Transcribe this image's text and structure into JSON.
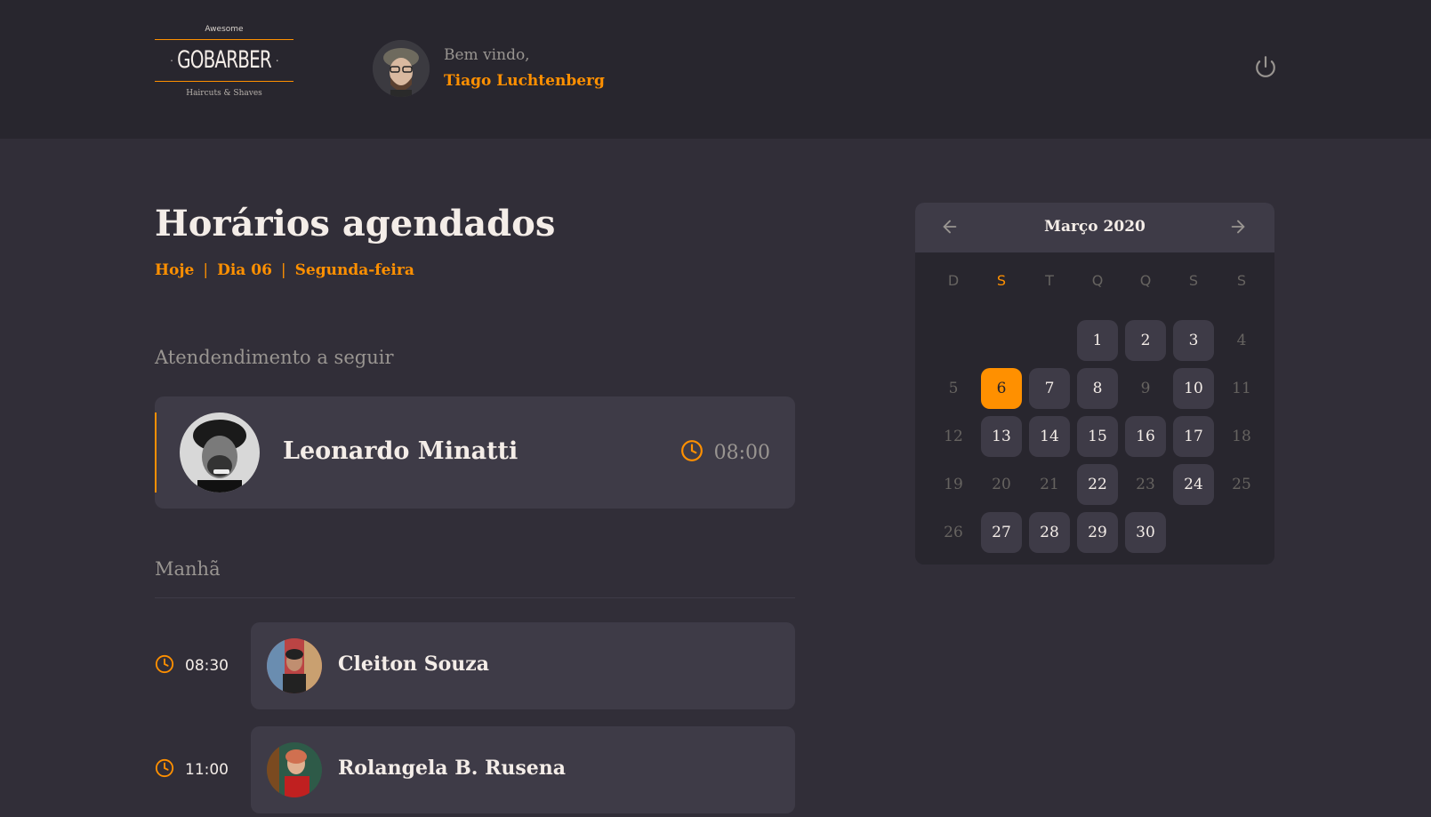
{
  "header": {
    "logo": {
      "top": "Awesome",
      "main": "GOBARBER",
      "bottom": "Haircuts & Shaves"
    },
    "greeting": "Bem vindo,",
    "user_name": "Tiago Luchtenberg"
  },
  "page": {
    "title": "Horários agendados",
    "subtitle": {
      "today": "Hoje",
      "sep": "|",
      "day": "Dia 06",
      "weekday": "Segunda-feira"
    }
  },
  "next_appointment": {
    "section_label": "Atendendimento a seguir",
    "name": "Leonardo Minatti",
    "time": "08:00"
  },
  "morning": {
    "section_label": "Manhã",
    "appointments": [
      {
        "time": "08:30",
        "name": "Cleiton Souza"
      },
      {
        "time": "11:00",
        "name": "Rolangela B. Rusena"
      }
    ]
  },
  "calendar": {
    "month_label": "Março 2020",
    "weekdays": [
      "D",
      "S",
      "T",
      "Q",
      "Q",
      "S",
      "S"
    ],
    "active_weekday_index": 1,
    "leading_blanks": 3,
    "days": [
      {
        "n": "1",
        "state": "avail"
      },
      {
        "n": "2",
        "state": "avail"
      },
      {
        "n": "3",
        "state": "avail"
      },
      {
        "n": "4",
        "state": "disabled"
      },
      {
        "n": "5",
        "state": "disabled"
      },
      {
        "n": "6",
        "state": "selected"
      },
      {
        "n": "7",
        "state": "avail"
      },
      {
        "n": "8",
        "state": "avail"
      },
      {
        "n": "9",
        "state": "disabled"
      },
      {
        "n": "10",
        "state": "avail"
      },
      {
        "n": "11",
        "state": "disabled"
      },
      {
        "n": "12",
        "state": "disabled"
      },
      {
        "n": "13",
        "state": "avail"
      },
      {
        "n": "14",
        "state": "avail"
      },
      {
        "n": "15",
        "state": "avail"
      },
      {
        "n": "16",
        "state": "avail"
      },
      {
        "n": "17",
        "state": "avail"
      },
      {
        "n": "18",
        "state": "disabled"
      },
      {
        "n": "19",
        "state": "disabled"
      },
      {
        "n": "20",
        "state": "disabled"
      },
      {
        "n": "21",
        "state": "disabled"
      },
      {
        "n": "22",
        "state": "avail"
      },
      {
        "n": "23",
        "state": "disabled"
      },
      {
        "n": "24",
        "state": "avail"
      },
      {
        "n": "25",
        "state": "disabled"
      },
      {
        "n": "26",
        "state": "disabled"
      },
      {
        "n": "27",
        "state": "avail"
      },
      {
        "n": "28",
        "state": "avail"
      },
      {
        "n": "29",
        "state": "avail"
      },
      {
        "n": "30",
        "state": "avail"
      }
    ]
  },
  "icons": {
    "logout": "power-icon",
    "clock": "clock-icon",
    "prev": "arrow-left-icon",
    "next": "arrow-right-icon"
  },
  "colors": {
    "accent": "#ff9000",
    "background": "#312e38",
    "header": "#28262e",
    "card": "#3e3b47",
    "muted": "#999591",
    "text": "#f4ede8"
  }
}
